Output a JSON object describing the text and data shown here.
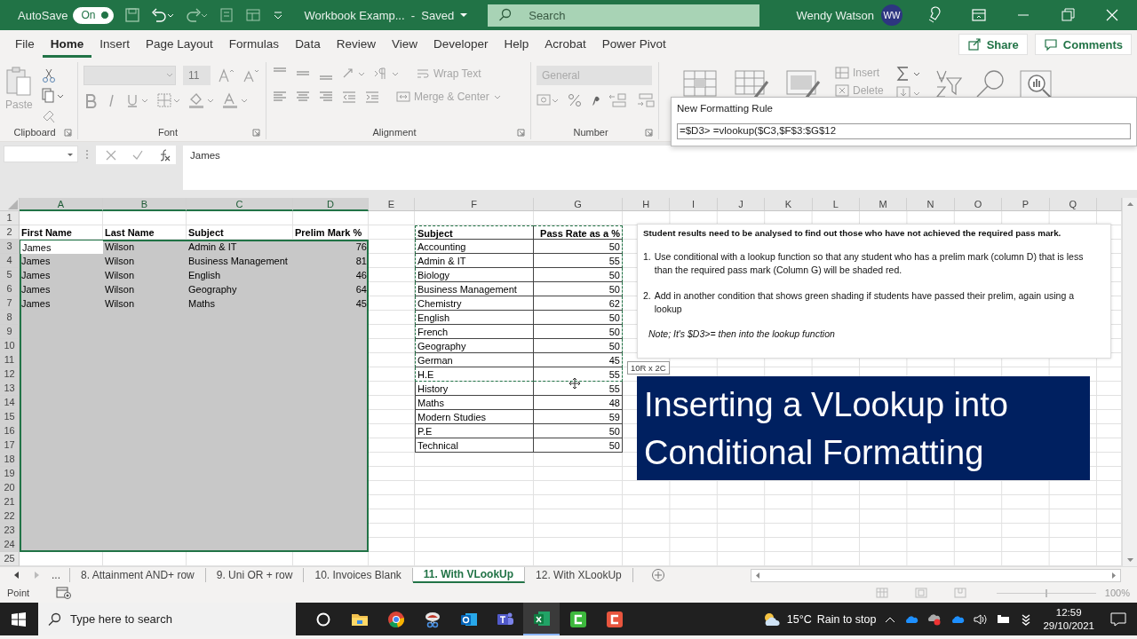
{
  "title_bar": {
    "autosave_label": "AutoSave",
    "autosave": {
      "label": "On",
      "on": true
    },
    "document_title": "Workbook Examp...  -  Saved",
    "search": {
      "placeholder": "Search"
    },
    "user_name": "Wendy Watson",
    "avatar_initials": "WW"
  },
  "menu": {
    "tabs": [
      {
        "label": "File",
        "selected": false
      },
      {
        "label": "Home",
        "selected": true
      },
      {
        "label": "Insert",
        "selected": false
      },
      {
        "label": "Page Layout",
        "selected": false
      },
      {
        "label": "Formulas",
        "selected": false
      },
      {
        "label": "Data",
        "selected": false
      },
      {
        "label": "Review",
        "selected": false
      },
      {
        "label": "View",
        "selected": false
      },
      {
        "label": "Developer",
        "selected": false
      },
      {
        "label": "Help",
        "selected": false
      },
      {
        "label": "Acrobat",
        "selected": false
      },
      {
        "label": "Power Pivot",
        "selected": false
      }
    ],
    "share": "Share",
    "comments": "Comments"
  },
  "ribbon": {
    "disabled": true,
    "paste": "Paste",
    "font_size": "11",
    "wrap_text": "Wrap Text",
    "merge_center": "Merge & Center",
    "number_format": "General",
    "insert": "Insert",
    "delete": "Delete",
    "groups": [
      "Clipboard",
      "Font",
      "Alignment",
      "Number"
    ]
  },
  "dialog": {
    "title": "New Formatting Rule",
    "formula": "=$D3> =vlookup($C3,$F$3:$G$12"
  },
  "formula_bar": {
    "value": "James"
  },
  "sheet": {
    "columns": [
      {
        "label": "A",
        "selected": true
      },
      {
        "label": "B",
        "selected": true
      },
      {
        "label": "C",
        "selected": true
      },
      {
        "label": "D",
        "selected": true
      },
      {
        "label": "E",
        "selected": false
      },
      {
        "label": "F",
        "selected": false
      },
      {
        "label": "G",
        "selected": false
      },
      {
        "label": "H",
        "selected": false
      },
      {
        "label": "I",
        "selected": false
      },
      {
        "label": "J",
        "selected": false
      },
      {
        "label": "K",
        "selected": false
      },
      {
        "label": "L",
        "selected": false
      },
      {
        "label": "M",
        "selected": false
      },
      {
        "label": "N",
        "selected": false
      },
      {
        "label": "O",
        "selected": false
      },
      {
        "label": "P",
        "selected": false
      },
      {
        "label": "Q",
        "selected": false
      }
    ],
    "rows": [
      {
        "number": "1",
        "selected": false
      },
      {
        "number": "2",
        "selected": false
      },
      {
        "number": "3",
        "selected": true
      },
      {
        "number": "4",
        "selected": true
      },
      {
        "number": "5",
        "selected": true
      },
      {
        "number": "6",
        "selected": true
      },
      {
        "number": "7",
        "selected": true
      },
      {
        "number": "8",
        "selected": true
      },
      {
        "number": "9",
        "selected": true
      },
      {
        "number": "10",
        "selected": true
      },
      {
        "number": "11",
        "selected": true
      },
      {
        "number": "12",
        "selected": true
      },
      {
        "number": "13",
        "selected": true
      },
      {
        "number": "14",
        "selected": true
      },
      {
        "number": "15",
        "selected": true
      },
      {
        "number": "16",
        "selected": true
      },
      {
        "number": "17",
        "selected": true
      },
      {
        "number": "18",
        "selected": true
      },
      {
        "number": "19",
        "selected": true
      },
      {
        "number": "20",
        "selected": true
      },
      {
        "number": "21",
        "selected": true
      },
      {
        "number": "22",
        "selected": true
      },
      {
        "number": "23",
        "selected": true
      },
      {
        "number": "24",
        "selected": true
      },
      {
        "number": "25",
        "selected": false
      }
    ],
    "student_table": {
      "header": [
        "First Name",
        "Last Name",
        "Subject",
        "Prelim Mark %"
      ],
      "rows": [
        {
          "cells": [
            {
              "text": "James",
              "active": true
            },
            {
              "text": "Wilson",
              "active": false
            },
            {
              "text": "Admin & IT",
              "active": false
            },
            {
              "text": "76",
              "active": false
            }
          ]
        },
        {
          "cells": [
            {
              "text": "James",
              "active": false
            },
            {
              "text": "Wilson",
              "active": false
            },
            {
              "text": "Business Management",
              "active": false
            },
            {
              "text": "81",
              "active": false
            }
          ]
        },
        {
          "cells": [
            {
              "text": "James",
              "active": false
            },
            {
              "text": "Wilson",
              "active": false
            },
            {
              "text": "English",
              "active": false
            },
            {
              "text": "46",
              "active": false
            }
          ]
        },
        {
          "cells": [
            {
              "text": "James",
              "active": false
            },
            {
              "text": "Wilson",
              "active": false
            },
            {
              "text": "Geography",
              "active": false
            },
            {
              "text": "64",
              "active": false
            }
          ]
        },
        {
          "cells": [
            {
              "text": "James",
              "active": false
            },
            {
              "text": "Wilson",
              "active": false
            },
            {
              "text": "Maths",
              "active": false
            },
            {
              "text": "45",
              "active": false
            }
          ]
        }
      ]
    },
    "lookup_table": {
      "header": [
        "Subject",
        "Pass Rate as a %"
      ],
      "header_copied": true,
      "rows": [
        {
          "subject": "Accounting",
          "pass_rate": "50",
          "copied": true
        },
        {
          "subject": "Admin & IT",
          "pass_rate": "55",
          "copied": true
        },
        {
          "subject": "Biology",
          "pass_rate": "50",
          "copied": true
        },
        {
          "subject": "Business Management",
          "pass_rate": "50",
          "copied": true
        },
        {
          "subject": "Chemistry",
          "pass_rate": "62",
          "copied": true
        },
        {
          "subject": "English",
          "pass_rate": "50",
          "copied": true
        },
        {
          "subject": "French",
          "pass_rate": "50",
          "copied": true
        },
        {
          "subject": "Geography",
          "pass_rate": "50",
          "copied": true
        },
        {
          "subject": "German",
          "pass_rate": "45",
          "copied": true
        },
        {
          "subject": "H.E",
          "pass_rate": "55",
          "copied": true
        },
        {
          "subject": "History",
          "pass_rate": "55",
          "copied": false
        },
        {
          "subject": "Maths",
          "pass_rate": "48",
          "copied": false
        },
        {
          "subject": "Modern Studies",
          "pass_rate": "59",
          "copied": false
        },
        {
          "subject": "P.E",
          "pass_rate": "50",
          "copied": false
        },
        {
          "subject": "Technical",
          "pass_rate": "50",
          "copied": false
        }
      ]
    }
  },
  "text_box": {
    "heading": "Student results need to be analysed to find out those who have not achieved the required pass mark.",
    "items": [
      {
        "number": "1.",
        "text": "Use conditional with a lookup function so that any student who has a prelim mark (column D) that is less than the required pass mark (Column G) will be shaded red."
      },
      {
        "number": "2.",
        "text": "Add in another condition that shows green shading if students have passed their prelim, again using a lookup"
      }
    ],
    "note": "Note; It's $D3>= then into the lookup function"
  },
  "banner": {
    "text": "Inserting a VLookup into Conditional Formatting"
  },
  "tooltip": {
    "text": "10R x 2C"
  },
  "sheet_tabs": {
    "more": "...",
    "tabs": [
      {
        "label": "8. Attainment AND+ row",
        "selected": false
      },
      {
        "label": "9. Uni OR + row",
        "selected": false
      },
      {
        "label": "10. Invoices Blank",
        "selected": false
      },
      {
        "label": "11. With VLookUp",
        "selected": true
      },
      {
        "label": "12. With XLookUp",
        "selected": false
      }
    ]
  },
  "status_bar": {
    "mode": "Point",
    "zoom_slider": {
      "level": 0.5
    },
    "zoom": "100%"
  },
  "taskbar": {
    "search": {
      "placeholder": "Type here to search"
    },
    "apps": [
      {
        "kind": "cortana",
        "selected": false
      },
      {
        "kind": "folder",
        "selected": false
      },
      {
        "kind": "browser",
        "selected": false
      },
      {
        "kind": "snip",
        "selected": false
      },
      {
        "kind": "outlook",
        "selected": false
      },
      {
        "kind": "teams",
        "selected": false
      },
      {
        "kind": "excel",
        "selected": true
      },
      {
        "kind": "green",
        "selected": false
      },
      {
        "kind": "red",
        "selected": false
      }
    ],
    "temperature": "15°C",
    "weather": "Rain to stop",
    "time": "12:59",
    "date": "29/10/2021"
  }
}
